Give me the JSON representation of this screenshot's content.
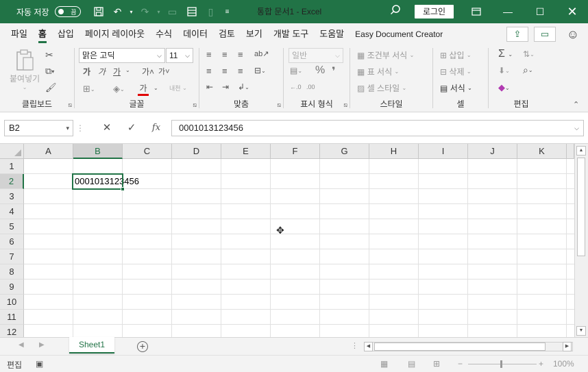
{
  "titlebar": {
    "autosave_label": "자동 저장",
    "autosave_state": "끔",
    "title": "통합 문서1  -  Excel",
    "login_label": "로그인",
    "accent": "#217346"
  },
  "tabs": [
    "파일",
    "홈",
    "삽입",
    "페이지 레이아웃",
    "수식",
    "데이터",
    "검토",
    "보기",
    "개발 도구",
    "도움말",
    "Easy Document Creator"
  ],
  "active_tab": "홈",
  "ribbon": {
    "clipboard": {
      "label": "클립보드",
      "paste": "붙여넣기"
    },
    "font": {
      "label": "글꼴",
      "font_name": "맑은 고딕",
      "font_size": "11",
      "bold": "가",
      "italic": "가",
      "underline": "가",
      "grow": "가˄",
      "shrink": "가˅",
      "color": "가",
      "phonetic": "내천"
    },
    "alignment": {
      "label": "맞춤"
    },
    "number": {
      "label": "표시 형식",
      "format": "일반",
      "percent": "%",
      "comma": "❜"
    },
    "styles": {
      "label": "스타일",
      "conditional": "조건부 서식",
      "table": "표 서식",
      "cell_style": "셀 스타일"
    },
    "cells": {
      "label": "셀",
      "insert": "삽입",
      "delete": "삭제",
      "format": "서식"
    },
    "editing": {
      "label": "편집",
      "sum": "Σ"
    }
  },
  "formulabar": {
    "name_box": "B2",
    "fx": "fx",
    "formula": "0001013123456"
  },
  "grid": {
    "columns": [
      "A",
      "B",
      "C",
      "D",
      "E",
      "F",
      "G",
      "H",
      "I",
      "J",
      "K"
    ],
    "rows": [
      "1",
      "2",
      "3",
      "4",
      "5",
      "6",
      "7",
      "8",
      "9",
      "10",
      "11",
      "12"
    ],
    "selected_column": "B",
    "selected_row": "2",
    "cell_b2": "0001013123456"
  },
  "sheets": [
    "Sheet1"
  ],
  "status": {
    "mode": "편집",
    "zoom": "100%"
  }
}
